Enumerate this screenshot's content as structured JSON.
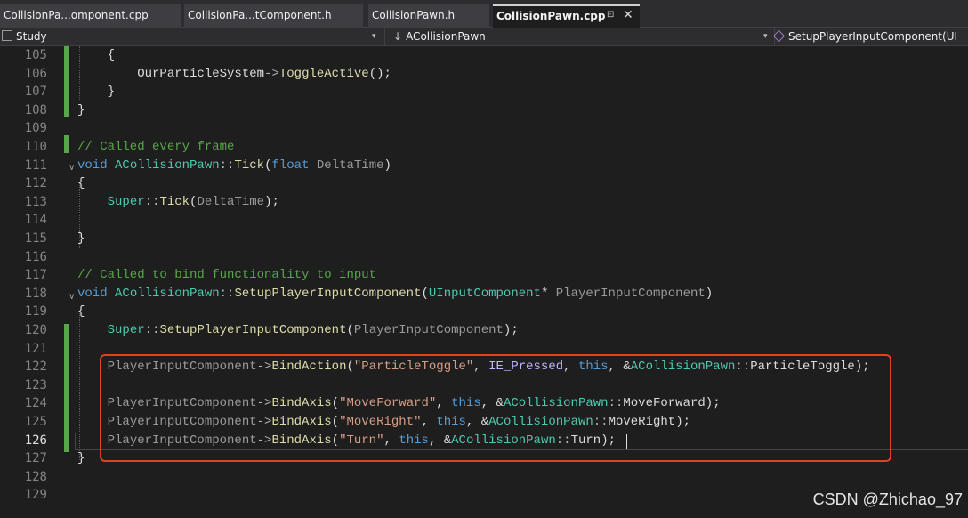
{
  "tabs": [
    {
      "label": "CollisionPa...omponent.cpp"
    },
    {
      "label": "CollisionPa...tComponent.h"
    },
    {
      "label": "CollisionPawn.h"
    },
    {
      "label": "CollisionPawn.cpp",
      "pin_glyph": "⊡",
      "close_glyph": "✕"
    }
  ],
  "nav": {
    "project": "Study",
    "class": "ACollisionPawn",
    "member": "SetupPlayerInputComponent(UI",
    "dropdown_glyph": "▾"
  },
  "editor": {
    "current_line": "126",
    "lines": [
      {
        "n": "105",
        "s": [
          "{"
        ]
      },
      {
        "n": "106",
        "s": [
          "OurParticleSystem",
          "->",
          "ToggleActive",
          "();"
        ]
      },
      {
        "n": "107",
        "s": [
          "}"
        ]
      },
      {
        "n": "108",
        "s": [
          "}"
        ]
      },
      {
        "n": "109",
        "s": []
      },
      {
        "n": "110",
        "s": [
          "// Called every frame"
        ]
      },
      {
        "n": "111",
        "s": [
          "void",
          " ",
          "ACollisionPawn",
          "::",
          "Tick",
          "(",
          "float",
          " ",
          "DeltaTime",
          ")"
        ]
      },
      {
        "n": "112",
        "s": [
          "{"
        ]
      },
      {
        "n": "113",
        "s": [
          "Super",
          "::",
          "Tick",
          "(",
          "DeltaTime",
          ");"
        ]
      },
      {
        "n": "114",
        "s": []
      },
      {
        "n": "115",
        "s": [
          "}"
        ]
      },
      {
        "n": "116",
        "s": []
      },
      {
        "n": "117",
        "s": [
          "// Called to bind functionality to input"
        ]
      },
      {
        "n": "118",
        "s": [
          "void",
          " ",
          "ACollisionPawn",
          "::",
          "SetupPlayerInputComponent",
          "(",
          "UInputComponent",
          "*",
          " ",
          "PlayerInputComponent",
          ")"
        ]
      },
      {
        "n": "119",
        "s": [
          "{"
        ]
      },
      {
        "n": "120",
        "s": [
          "Super",
          "::",
          "SetupPlayerInputComponent",
          "(",
          "PlayerInputComponent",
          ");"
        ]
      },
      {
        "n": "121",
        "s": []
      },
      {
        "n": "122",
        "s": [
          "PlayerInputComponent",
          "->",
          "BindAction",
          "(",
          "\"ParticleToggle\"",
          ", ",
          "IE_Pressed",
          ", ",
          "this",
          ", &",
          "ACollisionPawn",
          "::",
          "ParticleToggle",
          ");"
        ]
      },
      {
        "n": "123",
        "s": []
      },
      {
        "n": "124",
        "s": [
          "PlayerInputComponent",
          "->",
          "BindAxis",
          "(",
          "\"MoveForward\"",
          ", ",
          "this",
          ", &",
          "ACollisionPawn",
          "::",
          "MoveForward",
          ");"
        ]
      },
      {
        "n": "125",
        "s": [
          "PlayerInputComponent",
          "->",
          "BindAxis",
          "(",
          "\"MoveRight\"",
          ", ",
          "this",
          ", &",
          "ACollisionPawn",
          "::",
          "MoveRight",
          ");"
        ]
      },
      {
        "n": "126",
        "s": [
          "PlayerInputComponent",
          "->",
          "BindAxis",
          "(",
          "\"Turn\"",
          ", ",
          "this",
          ", &",
          "ACollisionPawn",
          "::",
          "Turn",
          ");"
        ]
      },
      {
        "n": "127",
        "s": [
          "}"
        ]
      },
      {
        "n": "128",
        "s": []
      },
      {
        "n": "129",
        "s": []
      }
    ]
  },
  "watermark": "CSDN @Zhichao_97",
  "colors": {
    "background": "#1e1e1e",
    "keyword": "#569cd6",
    "type": "#4ec9b0",
    "function": "#dcdcaa",
    "string": "#d69d85",
    "parameter": "#9a9a9a",
    "comment": "#57a64a",
    "macro": "#beb7ff",
    "change_bar": "#57a64a",
    "highlight_box": "#e0421c"
  }
}
